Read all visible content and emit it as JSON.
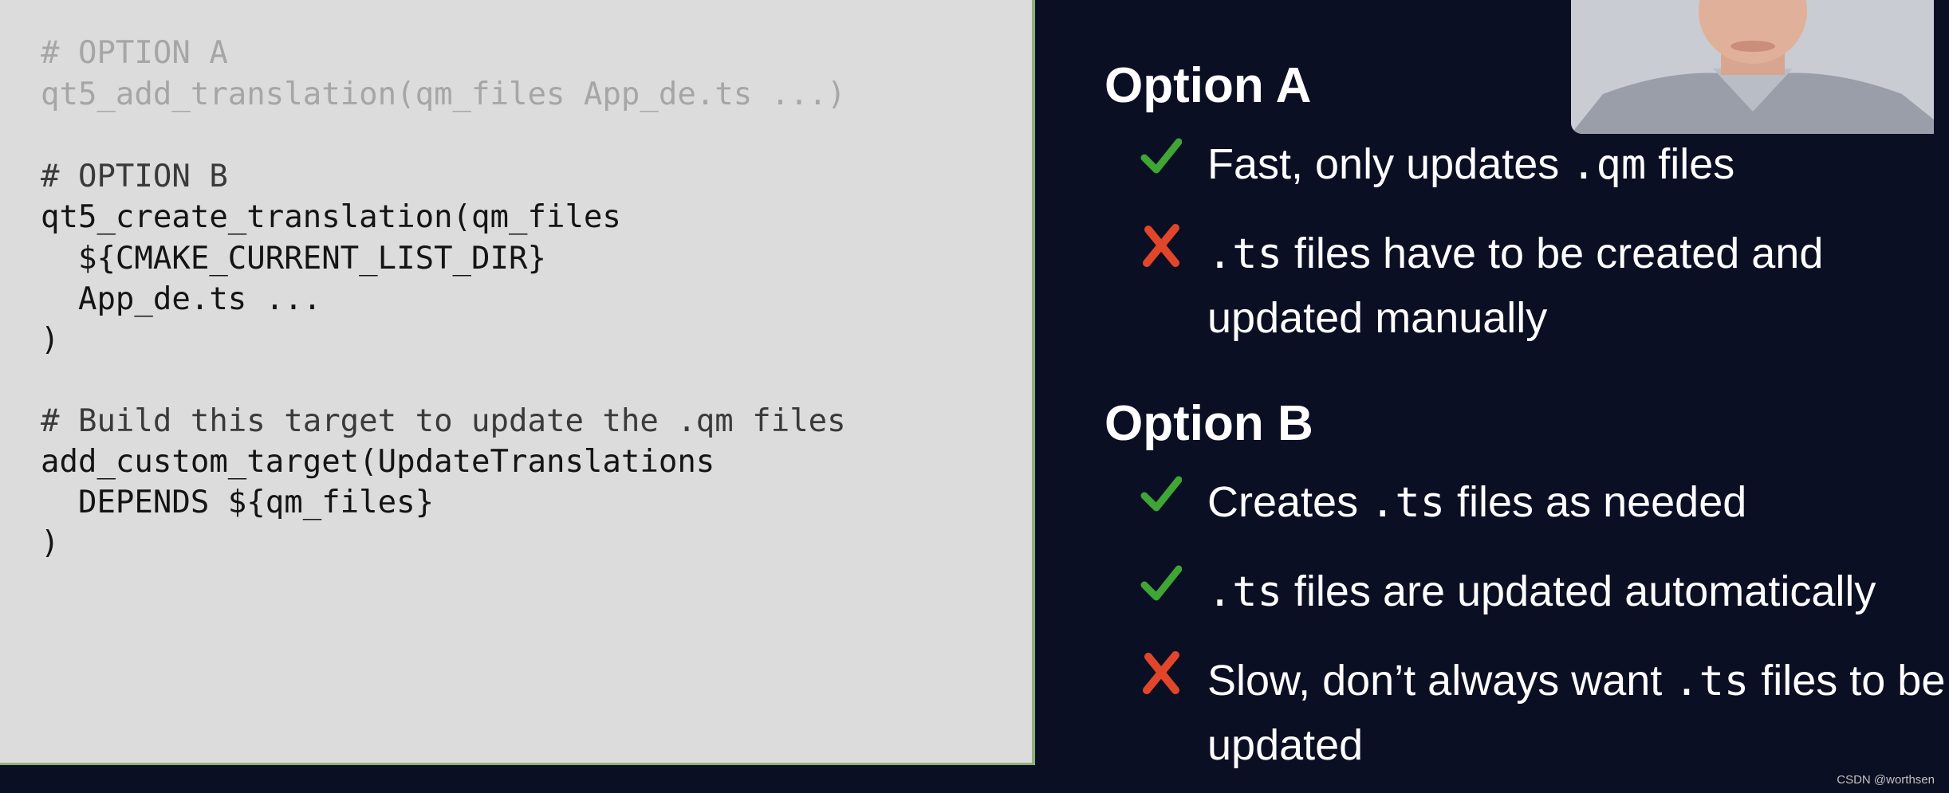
{
  "code_panel": {
    "lines": [
      {
        "text": "# OPTION A"
      },
      {
        "text": "qt5_add_translation(qm_files App_de.ts ...)"
      },
      {
        "text": "# OPTION B"
      },
      {
        "text": "qt5_create_translation(qm_files"
      },
      {
        "text": "  ${CMAKE_CURRENT_LIST_DIR}"
      },
      {
        "text": "  App_de.ts ..."
      },
      {
        "text": ")"
      },
      {
        "text": "# Build this target to update the .qm files"
      },
      {
        "text": "add_custom_target(UpdateTranslations"
      },
      {
        "text": "  DEPENDS ${qm_files}"
      },
      {
        "text": ")"
      }
    ]
  },
  "slides": {
    "option_a": {
      "title": "Option A",
      "bullets": [
        {
          "type": "pro",
          "parts": [
            "Fast, only updates ",
            ".qm",
            " files"
          ]
        },
        {
          "type": "con",
          "parts": [
            "",
            ".ts",
            " files have to be created and updated manually"
          ]
        }
      ]
    },
    "option_b": {
      "title": "Option B",
      "bullets": [
        {
          "type": "pro",
          "parts": [
            "Creates ",
            ".ts",
            " files as needed"
          ]
        },
        {
          "type": "pro",
          "parts": [
            "",
            ".ts",
            " files are updated automatically"
          ]
        },
        {
          "type": "con",
          "parts": [
            "Slow, don’t always want ",
            ".ts",
            " files to be updated"
          ]
        }
      ]
    }
  },
  "icons": {
    "pro": "check-icon",
    "con": "cross-icon"
  },
  "colors": {
    "background": "#0b0f24",
    "code_background": "#dcdcdc",
    "panel_border": "#8fb07a",
    "check": "#3fa535",
    "cross": "#e2462a"
  },
  "footer": {
    "watermark": "CSDN @worthsen"
  }
}
